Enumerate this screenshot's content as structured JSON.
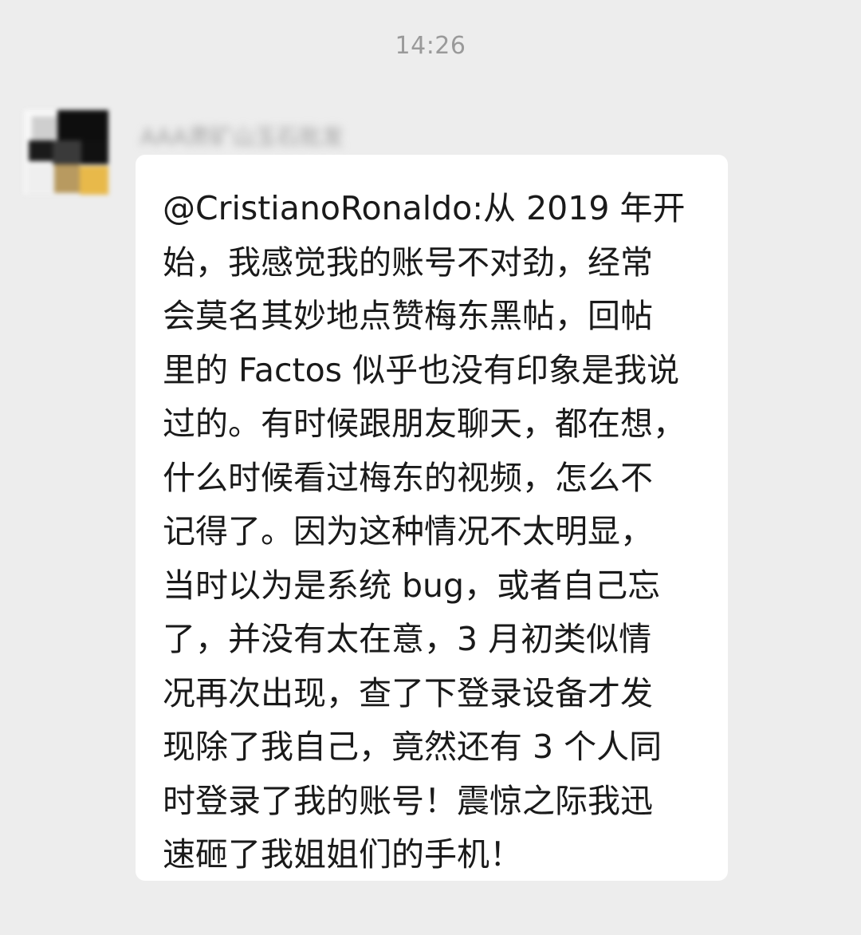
{
  "chat": {
    "timestamp": "14:26",
    "message": {
      "sender_name": "AAA肃矿山玉石批发",
      "avatar": "avatar-image-blurred",
      "text_lines": [
        "@CristianoRonaldo:从 2019 年开",
        "始，我感觉我的账号不对劲，经常",
        "会莫名其妙地点赞梅东黑帖，回帖",
        "里的 Factos 似乎也没有印象是我说",
        "过的。有时候跟朋友聊天，都在想，",
        "什么时候看过梅东的视频，怎么不",
        "记得了。因为这种情况不太明显，",
        "当时以为是系统 bug，或者自己忘",
        "了，并没有太在意，3 月初类似情",
        "况再次出现，查了下登录设备才发",
        "现除了我自己，竟然还有 3 个人同",
        "时登录了我的账号！震惊之际我迅",
        "速砸了我姐姐们的手机！"
      ]
    }
  },
  "colors": {
    "background": "#ededed",
    "bubble": "#ffffff",
    "text": "#1a1a1a",
    "timestamp": "#9a9a9a"
  }
}
